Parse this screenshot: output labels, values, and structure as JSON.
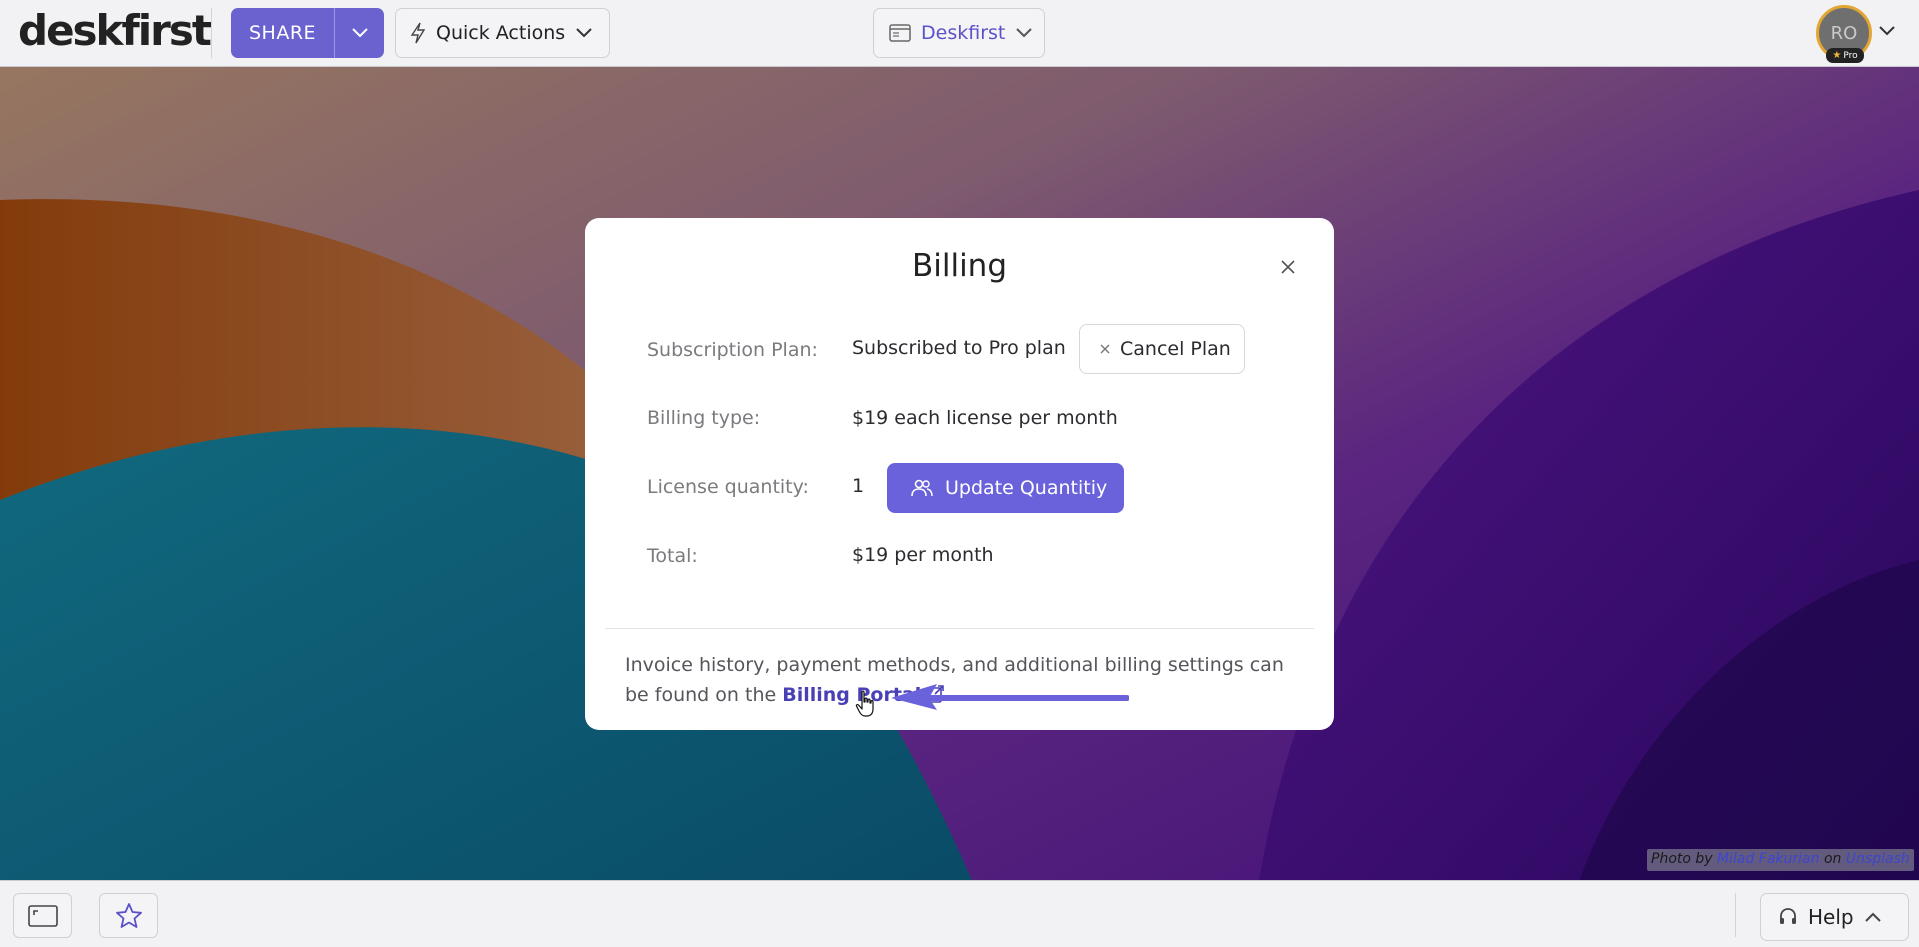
{
  "topbar": {
    "logo": "deskfirst",
    "share_label": "SHARE",
    "quick_actions_label": "Quick Actions",
    "workspace_label": "Deskfirst",
    "avatar_initials": "RO",
    "avatar_badge": "Pro"
  },
  "modal": {
    "title": "Billing",
    "rows": [
      {
        "label": "Subscription Plan:",
        "value": "Subscribed to Pro plan"
      },
      {
        "label": "Billing type:",
        "value": "$19 each license per month"
      },
      {
        "label": "License quantity:",
        "value": "1"
      },
      {
        "label": "Total:",
        "value": "$19 per month"
      }
    ],
    "cancel_label": "Cancel Plan",
    "update_label": "Update Quantitiy",
    "footer_text_1": "Invoice history, payment methods, and additional billing settings can be found on the ",
    "portal_link": "Billing Portal"
  },
  "credit": {
    "prefix": "Photo by ",
    "author": "Milad Fakurian",
    "middle": " on ",
    "source": "Unsplash"
  },
  "bottombar": {
    "help_label": "Help"
  },
  "colors": {
    "accent": "#6a62db",
    "link": "#4a40b6",
    "badge_star": "#f2b63a"
  },
  "icons": [
    "caret-down-icon",
    "lightning-icon",
    "window-icon",
    "close-icon",
    "users-icon",
    "external-link-icon",
    "expand-icon",
    "star-icon",
    "headset-icon",
    "caret-up-icon",
    "arrow-icon",
    "hand-cursor-icon"
  ]
}
